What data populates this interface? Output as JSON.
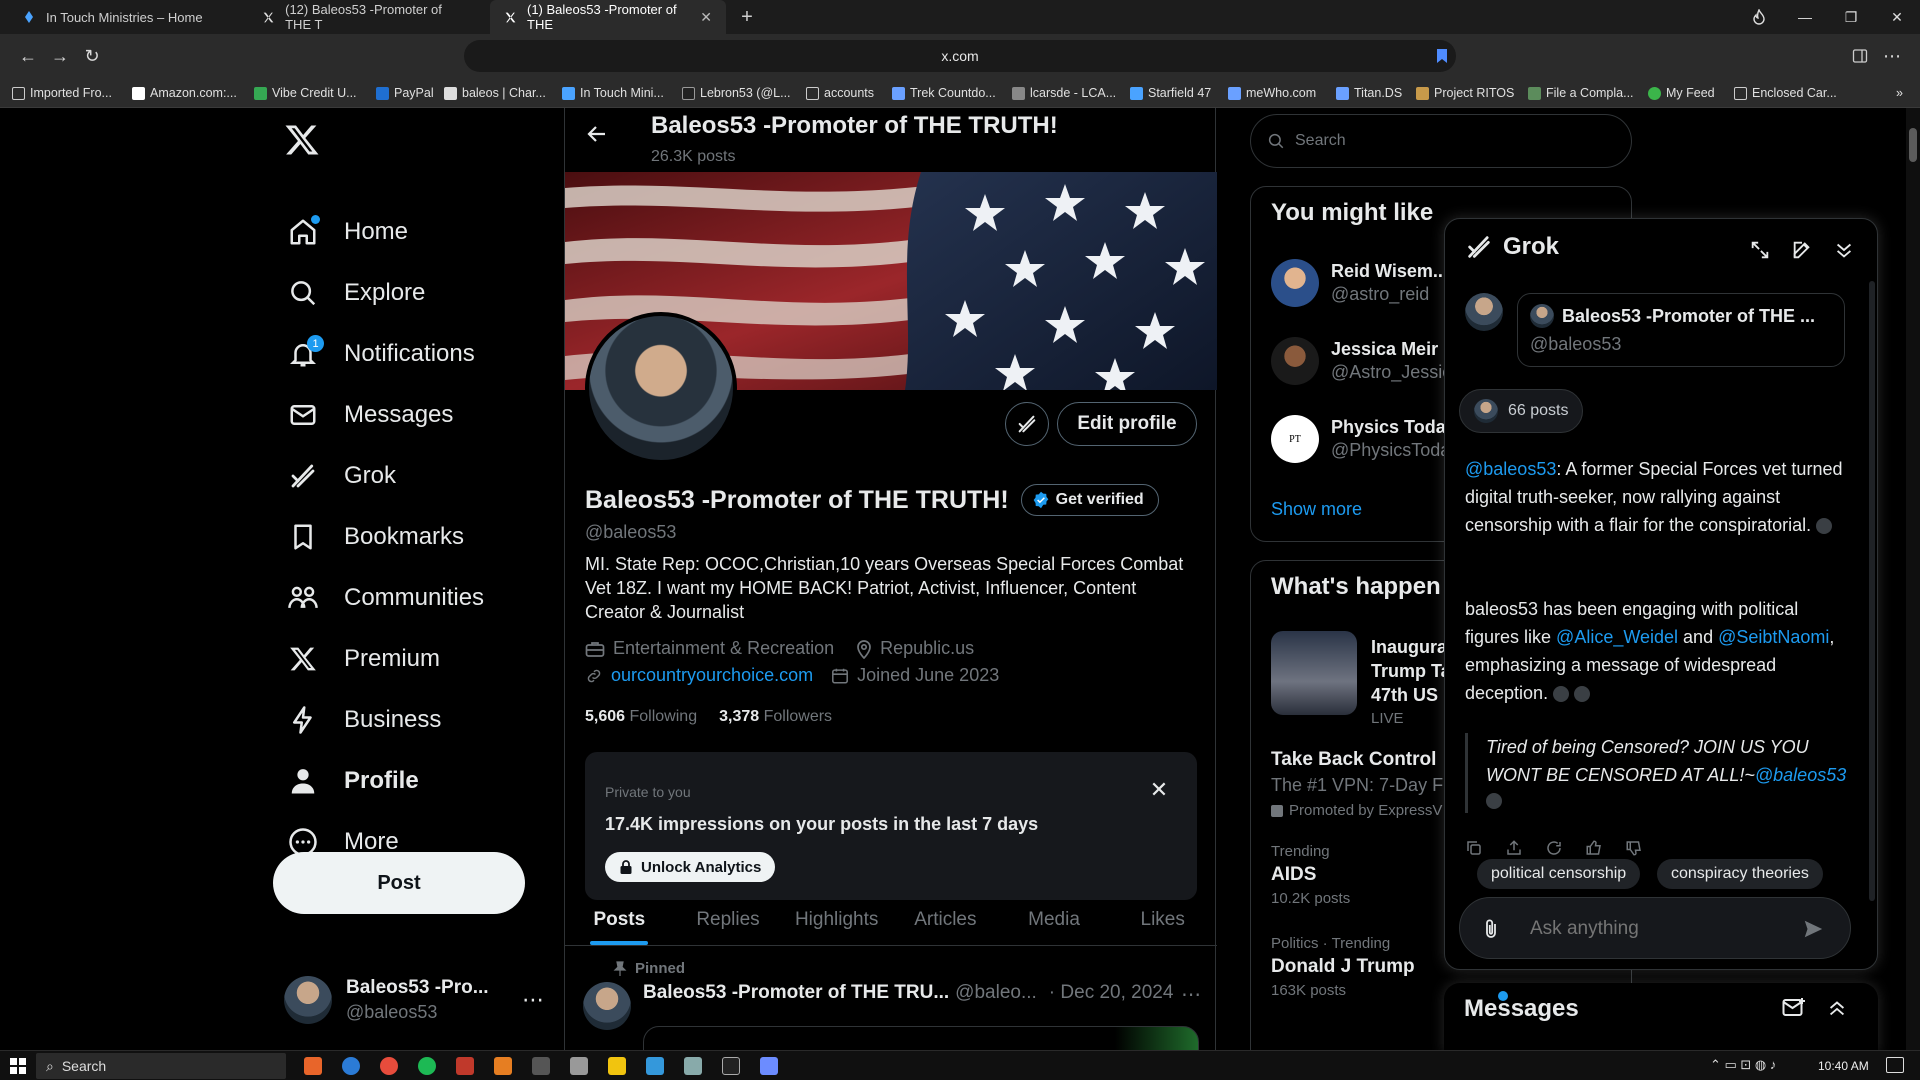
{
  "browser": {
    "tabs": [
      {
        "title": "In Touch Ministries – Home"
      },
      {
        "title": "(12) Baleos53 -Promoter of THE T"
      },
      {
        "title": "(1) Baleos53 -Promoter of THE"
      }
    ],
    "url": "x.com",
    "bookmarks": [
      "Imported Fro...",
      "Amazon.com:...",
      "Vibe Credit U...",
      "PayPal",
      "baleos | Char...",
      "In Touch Mini...",
      "Lebron53 (@L...",
      "accounts",
      "Trek Countdo...",
      "lcarsde - LCA...",
      "Starfield 47",
      "meWho.com",
      "Titan.DS",
      "Project RITOS",
      "File a Compla...",
      "My Feed",
      "Enclosed Car..."
    ]
  },
  "nav": {
    "items": [
      "Home",
      "Explore",
      "Notifications",
      "Messages",
      "Grok",
      "Bookmarks",
      "Communities",
      "Premium",
      "Business",
      "Profile",
      "More"
    ],
    "notif_count": "1",
    "post_label": "Post",
    "account_name": "Baleos53 -Pro...",
    "account_handle": "@baleos53"
  },
  "profile": {
    "header_name": "Baleos53 -Promoter of THE TRUTH!",
    "post_count": "26.3K posts",
    "name": "Baleos53 -Promoter of THE TRUTH!",
    "get_verified": "Get verified",
    "handle": "@baleos53",
    "edit_profile": "Edit profile",
    "bio": "MI. State Rep: OCOC,Christian,10 years Overseas Special Forces Combat Vet 18Z. I want my HOME BACK! Patriot, Activist, Influencer, Content Creator & Journalist",
    "category": "Entertainment & Recreation",
    "location": "Republic.us",
    "website": "ourcountryourchoice.com",
    "joined": "Joined June 2023",
    "following_count": "5,606",
    "following_label": "Following",
    "followers_count": "3,378",
    "followers_label": "Followers"
  },
  "analytics": {
    "private_label": "Private to you",
    "impressions": "17.4K impressions on your posts in the last 7 days",
    "unlock": "Unlock Analytics"
  },
  "tabs": [
    "Posts",
    "Replies",
    "Highlights",
    "Articles",
    "Media",
    "Likes"
  ],
  "pinned": {
    "label": "Pinned",
    "name": "Baleos53 -Promoter of THE TRU...",
    "handle": "@baleo...",
    "date": "· Dec 20, 2024"
  },
  "sidebar": {
    "search_placeholder": "Search",
    "you_might_like": "You might like",
    "suggestions": [
      {
        "name": "Reid Wisem...",
        "handle": "@astro_reid"
      },
      {
        "name": "Jessica Meir",
        "handle": "@Astro_Jessic"
      },
      {
        "name": "Physics Toda",
        "handle": "@PhysicsToda"
      }
    ],
    "show_more": "Show more",
    "whats_happening": "What's happen",
    "trends": [
      {
        "lines": [
          "Inaugura",
          "Trump Ta",
          "47th US"
        ],
        "meta": "LIVE"
      },
      {
        "title": "Take Back Control",
        "sub": "The #1 VPN: 7-Day Fr",
        "meta": "Promoted by ExpressV"
      },
      {
        "context": "Trending",
        "title": "AIDS",
        "meta": "10.2K posts"
      },
      {
        "context": "Politics · Trending",
        "title": "Donald J Trump",
        "meta": "163K posts"
      }
    ]
  },
  "grok": {
    "title": "Grok",
    "card_name": "Baleos53 -Promoter of THE ...",
    "card_handle": "@baleos53",
    "posts_chip": "66 posts",
    "p1_mention": "@baleos53",
    "p1_text": ": A former Special Forces vet turned digital truth-seeker, now rallying against censorship with a flair for the conspiratorial.",
    "p2_start": "baleos53 has been engaging with political figures like ",
    "p2_m1": "@Alice_Weidel",
    "p2_and": " and ",
    "p2_m2": "@SeibtNaomi",
    "p2_end": ", emphasizing a message of widespread deception.",
    "quote_text": "Tired of being Censored? JOIN US YOU WONT BE CENSORED AT ALL!~",
    "quote_mention": "@baleos53",
    "tags": [
      "political censorship",
      "conspiracy theories"
    ],
    "input_placeholder": "Ask anything"
  },
  "messages_dock": {
    "title": "Messages"
  },
  "taskbar": {
    "search": "Search",
    "time": "10:40 AM"
  },
  "colors": {
    "accent": "#1d9bf0",
    "bg": "#000000",
    "muted": "#71767b",
    "text": "#e7e9ea"
  }
}
